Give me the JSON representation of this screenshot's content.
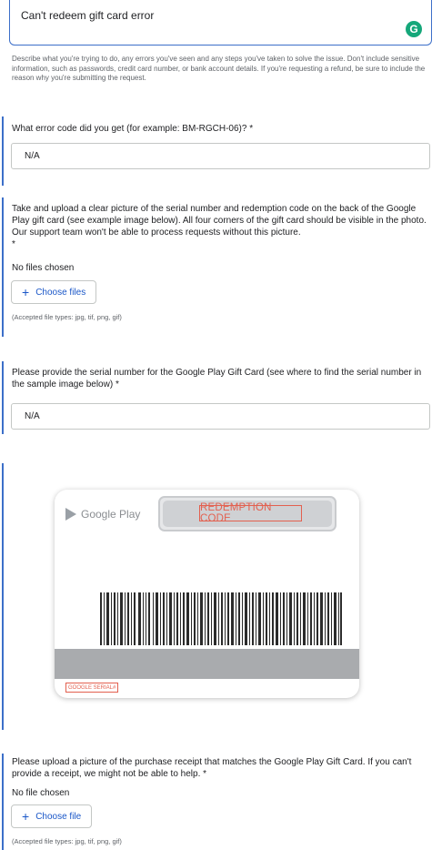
{
  "description_field": {
    "value": "Can't redeem gift card error",
    "badge": "G",
    "badge_color": "#15a77a",
    "help_text": "Describe what you're trying to do, any errors you've seen and any steps you've taken to solve the issue. Don't include sensitive information, such as passwords, credit card number, or bank account details. If you're requesting a refund, be sure to include the reason why you're submitting the request."
  },
  "error_code": {
    "label": "What error code did you get (for example: BM-RGCH-06)? *",
    "value": "N/A"
  },
  "gift_card_picture": {
    "label": "Take and upload a clear picture of the serial number and redemption code on the back of the Google Play gift card (see example image below). All four corners of the gift card should be visible in the photo. Our support team won't be able to process requests without this picture.",
    "required_mark": "*",
    "status": "No files chosen",
    "button_label": "Choose files",
    "accepted": "(Accepted file types: jpg, tif, png, gif)"
  },
  "serial_number": {
    "label": "Please provide the serial number for the Google Play Gift Card (see where to find the serial number in the sample image below) *",
    "value": "N/A"
  },
  "sample_card": {
    "brand": "Google Play",
    "redemption_label": "REDEMPTION CODE",
    "serial_label": "GOOGLE SERIAL#",
    "highlight_color": "#e3604f"
  },
  "receipt_picture": {
    "label": "Please upload a picture of the purchase receipt that matches the Google Play Gift Card. If you can't provide a receipt, we might not be able to help. *",
    "status": "No file chosen",
    "button_label": "Choose file",
    "accepted": "(Accepted file types: jpg, tif, png, gif)"
  },
  "colors": {
    "accent": "#3c6fc9",
    "link": "#1a57c8"
  }
}
